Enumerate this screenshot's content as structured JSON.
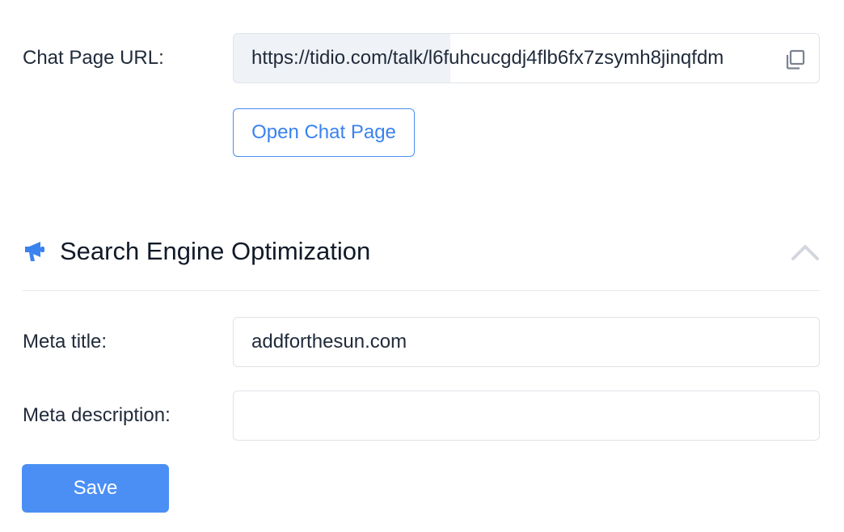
{
  "chat_page": {
    "label": "Chat Page URL:",
    "url": "https://tidio.com/talk/l6fuhcucgdj4flb6fx7zsymh8jinqfdm",
    "copy_icon": "copy-icon",
    "open_button_label": "Open Chat Page"
  },
  "seo_section": {
    "icon": "megaphone-icon",
    "title": "Search Engine Optimization",
    "collapse_icon": "chevron-up-icon",
    "meta_title": {
      "label": "Meta title:",
      "value": "addforthesun.com"
    },
    "meta_description": {
      "label": "Meta description:",
      "value": ""
    }
  },
  "actions": {
    "save_label": "Save"
  },
  "colors": {
    "accent": "#4b8ff5",
    "link": "#3a82ee",
    "border": "#dfe3e8"
  }
}
